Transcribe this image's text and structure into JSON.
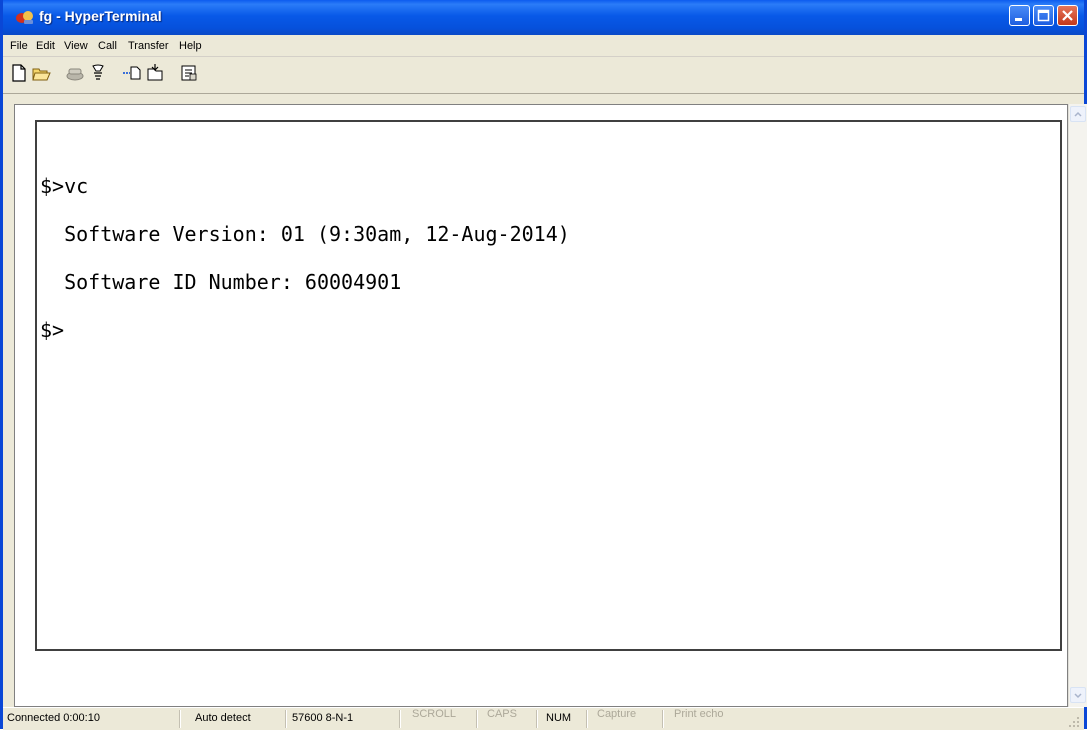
{
  "window": {
    "title": "fg - HyperTerminal",
    "icon": "hyperterminal-app-icon",
    "controls": [
      "minimize-icon",
      "maximize-icon",
      "close-icon"
    ]
  },
  "menu": {
    "items": [
      {
        "label": "File"
      },
      {
        "label": "Edit"
      },
      {
        "label": "View"
      },
      {
        "label": "Call"
      },
      {
        "label": "Transfer"
      },
      {
        "label": "Help"
      }
    ]
  },
  "toolbar": {
    "buttons": [
      {
        "icon": "new-document-icon"
      },
      {
        "icon": "open-folder-icon"
      },
      {
        "icon": "call-icon"
      },
      {
        "icon": "disconnect-icon"
      },
      {
        "icon": "send-icon"
      },
      {
        "icon": "receive-icon"
      },
      {
        "icon": "properties-icon"
      }
    ]
  },
  "terminal": {
    "lines": [
      "$>vc",
      "  Software Version: 01 (9:30am, 12-Aug-2014)",
      "  Software ID Number: 60004901",
      "$>"
    ]
  },
  "status": {
    "connected": "Connected 0:00:10",
    "detect": "Auto detect",
    "settings": "57600 8-N-1",
    "scroll": "SCROLL",
    "caps": "CAPS",
    "num": "NUM",
    "capture": "Capture",
    "print_echo": "Print echo"
  },
  "colors": {
    "titlebar": "#0859e8",
    "chrome": "#ece9d8",
    "terminal_bg": "#ffffff",
    "terminal_text": "#000000"
  }
}
